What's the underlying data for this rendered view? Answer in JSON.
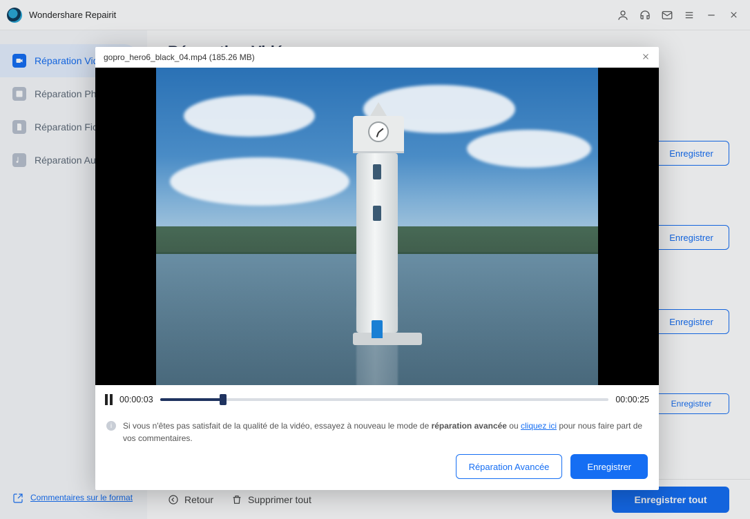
{
  "titlebar": {
    "app_name": "Wondershare Repairit"
  },
  "sidebar": {
    "items": [
      {
        "label": "Réparation Vidéo"
      },
      {
        "label": "Réparation Photo"
      },
      {
        "label": "Réparation Fichier"
      },
      {
        "label": "Réparation Audio"
      }
    ],
    "footer": "Commentaires sur le format"
  },
  "main": {
    "title": "Réparation Vidéo",
    "row_save": "Enregistrer",
    "back": "Retour",
    "delete_all": "Supprimer tout",
    "save_all": "Enregistrer tout"
  },
  "modal": {
    "filename": "gopro_hero6_black_04.mp4 (185.26 MB)",
    "elapsed": "00:00:03",
    "duration": "00:00:25",
    "msg_pre": "Si vous n'êtes pas satisfait de la qualité de la vidéo, essayez à nouveau le mode de ",
    "msg_bold": "réparation avancée",
    "msg_mid": " ou ",
    "msg_link": "cliquez ici",
    "msg_post": " pour nous faire part de vos commentaires.",
    "advanced": "Réparation Avancée",
    "save": "Enregistrer"
  }
}
